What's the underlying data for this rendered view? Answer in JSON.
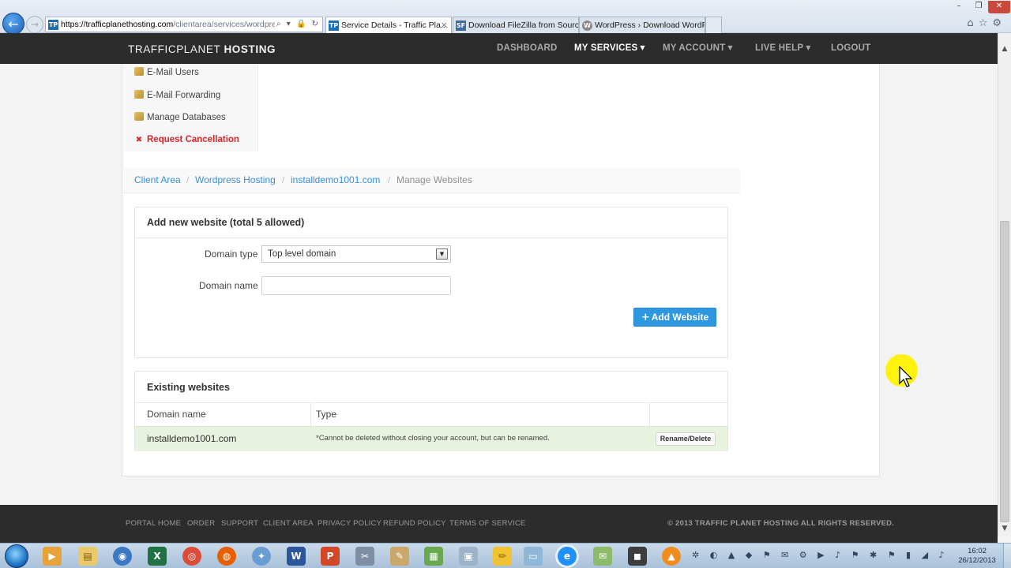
{
  "browser": {
    "url_domain": "https://trafficplanethosting.com",
    "url_path": "/clientarea/services/wordpress-h",
    "address_tools": "⌕ ▾ 🔒 ↻",
    "tabs": [
      {
        "label": "Service Details - Traffic Pla...",
        "close": "×"
      },
      {
        "label": "Download FileZilla from Sourc..."
      },
      {
        "label": "WordPress › Download WordP..."
      }
    ],
    "toolbar_icons": [
      "home-icon",
      "star-icon",
      "gear-icon"
    ],
    "window_controls": [
      "–",
      "❐",
      "✕"
    ]
  },
  "site": {
    "logo_light": "TRAFFICPLANET",
    "logo_bold": "HOSTING",
    "nav": [
      {
        "label": "DASHBOARD"
      },
      {
        "label": "MY SERVICES",
        "caret": "▼"
      },
      {
        "label": "MY ACCOUNT",
        "caret": "▼"
      },
      {
        "label": "LIVE HELP",
        "caret": "▼"
      },
      {
        "label": "LOGOUT"
      }
    ]
  },
  "side_menu": {
    "items": [
      {
        "label": "E-Mail Users"
      },
      {
        "label": "E-Mail Forwarding"
      },
      {
        "label": "Manage Databases"
      },
      {
        "label": "Request Cancellation",
        "icon": "✖"
      }
    ]
  },
  "breadcrumb": {
    "items": [
      "Client Area",
      "Wordpress Hosting",
      "installdemo1001.com",
      "Manage Websites"
    ],
    "separator": "/"
  },
  "add_website": {
    "title": "Add new website (total 5 allowed)",
    "domain_type_label": "Domain type",
    "domain_type_value": "Top level domain",
    "domain_type_arrow": "▼",
    "domain_name_label": "Domain name",
    "domain_name_value": "",
    "add_button_icon": "+",
    "add_button_label": "Add Website"
  },
  "existing_websites": {
    "title": "Existing websites",
    "columns": [
      "Domain name",
      "Type"
    ],
    "rows": [
      {
        "domain": "installdemo1001.com",
        "type": "*Cannot be deleted without closing your account, but can be renamed.",
        "action": "Rename/Delete"
      }
    ]
  },
  "footer": {
    "links": [
      "PORTAL HOME",
      "ORDER",
      "SUPPORT",
      "CLIENT AREA",
      "PRIVACY POLICY",
      "REFUND POLICY",
      "TERMS OF SERVICE"
    ],
    "copyright": "© 2013 TRAFFIC PLANET HOSTING ALL RIGHTS RESERVED."
  },
  "taskbar": {
    "time": "16:02",
    "date": "26/12/2013",
    "tray_icons": "✲ ◐ ▲ ◆ ⚑ ✉ ⚙ ▶ ♪ ⚑ ✱ ⚑ ▮ ◢ ♪"
  },
  "colors": {
    "header_bg": "#2c2c2c",
    "link_blue": "#3a8fd5",
    "primary_button": "#2d97e0",
    "danger_red": "#d9252a",
    "success_row": "#e7f2df"
  }
}
